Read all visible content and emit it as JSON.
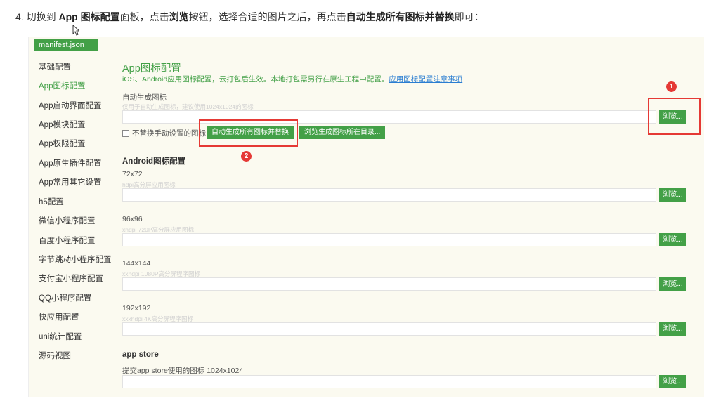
{
  "instruction": {
    "prefix": "4. 切换到 ",
    "app_icon": "App 图标配置",
    "mid1": "面板，点击",
    "browse": "浏览",
    "mid2": "按钮，选择合适的图片之后，再点击",
    "action": "自动生成所有图标并替换",
    "suffix": "即可："
  },
  "sidebar": {
    "file_tab": "manifest.json",
    "items": [
      {
        "label": "基础配置"
      },
      {
        "label": "App图标配置"
      },
      {
        "label": "App启动界面配置"
      },
      {
        "label": "App模块配置"
      },
      {
        "label": "App权限配置"
      },
      {
        "label": "App原生插件配置"
      },
      {
        "label": "App常用其它设置"
      },
      {
        "label": "h5配置"
      },
      {
        "label": "微信小程序配置"
      },
      {
        "label": "百度小程序配置"
      },
      {
        "label": "字节跳动小程序配置"
      },
      {
        "label": "支付宝小程序配置"
      },
      {
        "label": "QQ小程序配置"
      },
      {
        "label": "快应用配置"
      },
      {
        "label": "uni统计配置"
      },
      {
        "label": "源码视图"
      }
    ],
    "active_index": 1
  },
  "main": {
    "title": "App图标配置",
    "desc": "iOS、Android应用图标配置，云打包后生效。本地打包需另行在原生工程中配置。",
    "desc_link": "应用图标配置注意事项",
    "auto_label": "自动生成图标",
    "auto_hint": "仅用于自动生成图标，建议使用1024x1024的图标",
    "browse_label": "浏览...",
    "checkbox_label": "不替换手动设置的图标",
    "gen_button": "自动生成所有图标并替换",
    "open_dir_button": "浏览生成图标所在目录...",
    "android_title": "Android图标配置",
    "android_items": [
      {
        "size": "72x72",
        "hint": "hdpi高分屏应用图标"
      },
      {
        "size": "96x96",
        "hint": "xhdpi 720P高分屏应用图标"
      },
      {
        "size": "144x144",
        "hint": "xxhdpi 1080P高分屏程序图标"
      },
      {
        "size": "192x192",
        "hint": "xxxhdpi 4K高分屏程序图标"
      }
    ],
    "appstore_title": "app store",
    "appstore_label": "提交app store使用的图标 1024x1024"
  },
  "markers": {
    "one": "1",
    "two": "2"
  },
  "colors": {
    "accent": "#43a047",
    "highlight": "#e53935",
    "link": "#2a7dd1"
  }
}
